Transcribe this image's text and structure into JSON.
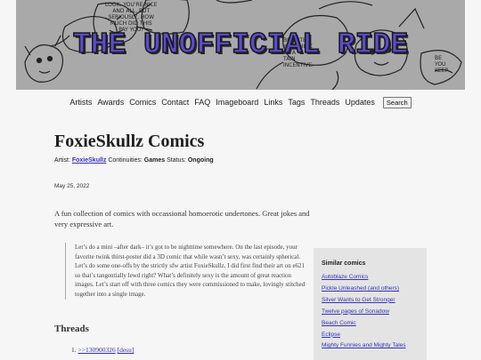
{
  "banner": {
    "title": "THE UNOFFICIAL RIDE",
    "bubble_left": "LOOK, YOU'RE NICE\nAND ALL, BUT\nSERIOUSLY, HOW\nMUCH DID THIS\nPAY YOU?",
    "bubble_right": "BE CUTE\nYOU THINK\nBE A\nTAIN\nINCENTIVE.",
    "bubble_far_right": "BE\nYOU\nKEEP"
  },
  "nav": {
    "items": [
      "Artists",
      "Awards",
      "Comics",
      "Contact",
      "FAQ",
      "Imageboard",
      "Links",
      "Tags",
      "Threads",
      "Updates"
    ],
    "search_label": "Search"
  },
  "page": {
    "title": "FoxieSkullz Comics",
    "artist_label": "Artist:",
    "artist": "FoxieSkullz",
    "continuities_label": "Continuities:",
    "continuities": "Games",
    "status_label": "Status:",
    "status": "Ongoing",
    "date": "May 25, 2022",
    "description": "A fun collection of comics with occassional homoerotic undertones. Great jokes and very expressive art.",
    "quote": "Let’s do a mini –after dark– it’s got to be nighttime somewhere. On the last episode, your favorite twink thirst-poster did a 3D comic that while wasn’t sexy, was certainly spherical. Let’s do some one-offs by the strictly sfw artist FoxieSkullz. I did first find their art on e621 so that’s tangentially lewd right? What’s definitely sexy is the amount of great reaction images. Let’s start off with three comics they were commissioned to make, lovingly stitched together into a single image.",
    "threads_heading": "Threads",
    "threads": [
      {
        "number": "1.",
        "id": ">>130900326",
        "tag": "[desu]"
      }
    ]
  },
  "sidebar": {
    "heading": "Similar comics",
    "items": [
      "Autoblaze Comics",
      "Pickle Unleashed (and others)",
      "Silver Wants to Get Stronger",
      "Twelve pages of Sonadow",
      "Beach Comic",
      "Eclipse",
      "Mighty Funnies and Mighty Tales"
    ]
  },
  "colors": {
    "banner_bg": "#a9a9a9",
    "title_fill": "#5b4bd6",
    "link": "#3333bb",
    "sidebar_bg": "#e4e4e4",
    "page_bg": "#f6f6f6"
  }
}
